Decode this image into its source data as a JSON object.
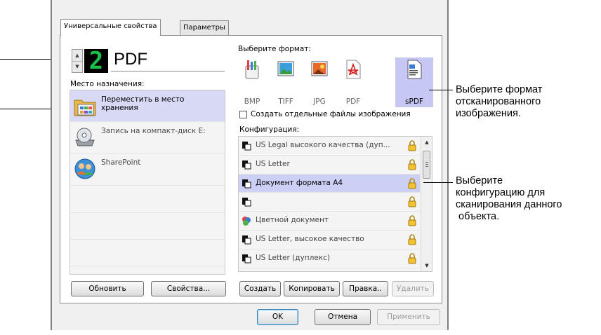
{
  "tabs": [
    {
      "label": "Универсальные свойства"
    },
    {
      "label": "Параметры"
    }
  ],
  "header": {
    "counter_digit": "2",
    "format_name": "PDF"
  },
  "destination": {
    "label": "Место назначения:",
    "items": [
      {
        "label": "Переместить в место хранения",
        "icon": "folder-grid-icon"
      },
      {
        "label": "Запись на компакт-диск  E:",
        "icon": "cd-drive-icon"
      },
      {
        "label": "SharePoint",
        "icon": "sharepoint-icon"
      }
    ]
  },
  "format": {
    "label": "Выберите формат:",
    "items": [
      {
        "label": "BMP",
        "icon": "bmp-icon"
      },
      {
        "label": "TIFF",
        "icon": "tiff-icon"
      },
      {
        "label": "JPG",
        "icon": "jpg-icon"
      },
      {
        "label": "PDF",
        "icon": "pdf-icon"
      },
      {
        "label": "sPDF",
        "icon": "spdf-icon"
      }
    ],
    "selected": "sPDF",
    "separate_files_label": "Создать отдельные файлы изображения"
  },
  "config": {
    "label": "Конфигурация:",
    "items": [
      {
        "label": "US Legal высокого качества (дуп...",
        "icon": "scanner-icon"
      },
      {
        "label": "US Letter",
        "icon": "scanner-icon"
      },
      {
        "label": "Документ формата A4",
        "icon": "scanner-icon"
      },
      {
        "label": "",
        "icon": "scanner-icon"
      },
      {
        "label": "Цветной документ",
        "icon": "color-palette-icon"
      },
      {
        "label": "US Letter, высокое качество",
        "icon": "scanner-icon"
      },
      {
        "label": "US Letter (дуплекс)",
        "icon": "scanner-icon"
      }
    ],
    "selected_index": 2
  },
  "buttons": {
    "refresh": "Обновить",
    "properties": "Свойства...",
    "create": "Создать",
    "copy": "Копировать",
    "edit": "Правка..",
    "delete": "Удалить",
    "ok": "OK",
    "cancel": "Отмена",
    "apply": "Применить"
  },
  "callouts": {
    "format": "Выберите формат\nотсканированного\nизображения.",
    "config": "Выберите\nконфигурацию для\nсканирования данного\n объекта."
  },
  "colors": {
    "selection": "#d7d9f5",
    "counter_digit": "#19c24a"
  }
}
